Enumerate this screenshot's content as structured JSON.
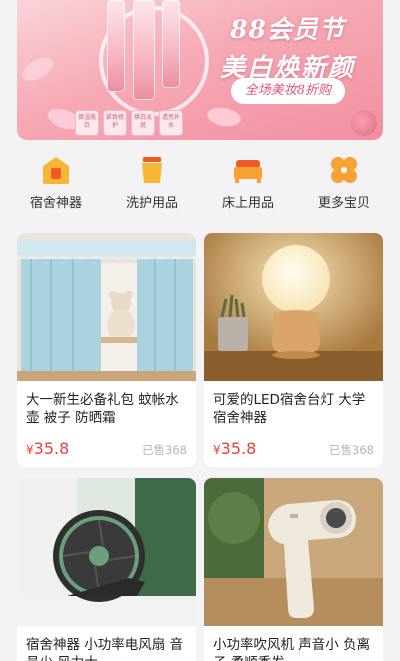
{
  "banner": {
    "headline_line1": "88会员节",
    "headline_line2": "美白焕新颜",
    "promo": "全场美妆8折购",
    "box_labels": [
      "保湿美白",
      "紧致修护",
      "焕白淡斑",
      "透亮补水"
    ]
  },
  "categories": [
    {
      "label": "宿舍神器",
      "icon": "house-icon",
      "color": "#f7b733"
    },
    {
      "label": "洗护用品",
      "icon": "cup-icon",
      "color": "#f7b733"
    },
    {
      "label": "床上用品",
      "icon": "bed-icon",
      "color": "#f7a233"
    },
    {
      "label": "更多宝贝",
      "icon": "clover-icon",
      "color": "#f7a233"
    }
  ],
  "products": [
    {
      "title": "大一新生必备礼包 蚊帐水壶 被子 防晒霜",
      "currency": "¥",
      "price": "35.8",
      "sold": "已售368",
      "image": "bed-curtain-photo"
    },
    {
      "title": "可爱的LED宿舍台灯 大学宿舍神器",
      "currency": "¥",
      "price": "35.8",
      "sold": "已售368",
      "image": "desk-lamp-photo"
    },
    {
      "title": "宿舍神器 小功率电风扇 音员少 风力大",
      "image": "desk-fan-photo"
    },
    {
      "title": "小功率吹风机 声音小 负离子 柔顺秀发",
      "image": "hair-dryer-photo"
    }
  ],
  "colors": {
    "price": "#e8403a",
    "sold": "#b5b5b5",
    "accent": "#f7b733"
  }
}
